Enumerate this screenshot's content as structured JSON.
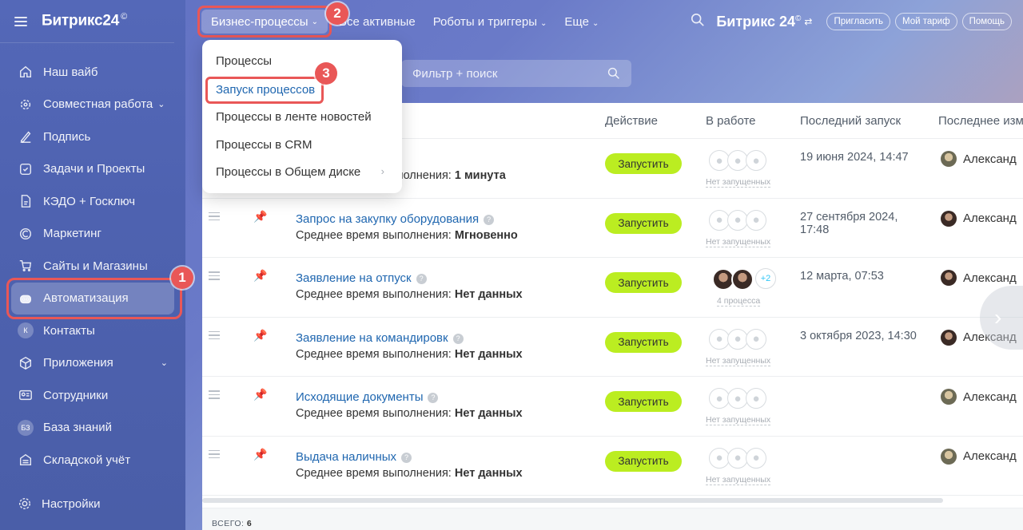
{
  "sidebar": {
    "logo": "Битрикс24",
    "logo_mark": "©",
    "items": [
      {
        "label": "Наш вайб",
        "icon": "home-icon"
      },
      {
        "label": "Совместная работа",
        "icon": "collab-icon"
      },
      {
        "label": "Подпись",
        "icon": "signature-icon"
      },
      {
        "label": "Задачи и Проекты",
        "icon": "tasks-icon"
      },
      {
        "label": "КЭДО + Госключ",
        "icon": "doc-icon"
      },
      {
        "label": "Маркетинг",
        "icon": "marketing-icon"
      },
      {
        "label": "Сайты и Магазины",
        "icon": "cart-icon"
      },
      {
        "label": "Автоматизация",
        "icon": "robot-icon"
      },
      {
        "label": "Контакты",
        "letter": "К"
      },
      {
        "label": "Приложения",
        "icon": "apps-icon"
      },
      {
        "label": "Сотрудники",
        "icon": "employees-icon"
      },
      {
        "label": "База знаний",
        "letter": "БЗ"
      },
      {
        "label": "Складской учёт",
        "icon": "warehouse-icon"
      }
    ],
    "settings": "Настройки"
  },
  "topbar": {
    "tabs": [
      "Бизнес-процессы",
      "Все активные",
      "Роботы и триггеры",
      "Еще"
    ],
    "logo": "Битрикс 24",
    "logo_mark": "©",
    "invite": "Пригласить",
    "plan": "Мой тариф",
    "help": "Помощь"
  },
  "dropdown": {
    "items": [
      "Процессы",
      "Запуск процессов",
      "Процессы в ленте новостей",
      "Процессы в CRM",
      "Процессы в Общем диске"
    ]
  },
  "filter": {
    "placeholder": "Фильтр + поиск"
  },
  "table": {
    "headers": [
      "Действие",
      "В работе",
      "Последний запуск",
      "Последнее изм"
    ],
    "run_label": "Запустить",
    "desc_prefix": "Среднее время выполнения: ",
    "rows": [
      {
        "name": "",
        "avg": "1 минута",
        "in_work": "Нет запущенных",
        "last_run": "19 июня 2024, 14:47",
        "editor": "Александ"
      },
      {
        "name": "Запрос на закупку оборудования",
        "avg": "Мгновенно",
        "in_work": "Нет запущенных",
        "last_run": "27 сентября 2024, 17:48",
        "editor": "Александ"
      },
      {
        "name": "Заявление на отпуск",
        "avg": "Нет данных",
        "in_work": "4 процесса",
        "extra": "+2",
        "last_run": "12 марта, 07:53",
        "editor": "Александ"
      },
      {
        "name": "Заявление на командировк",
        "avg": "Нет данных",
        "in_work": "Нет запущенных",
        "last_run": "3 октября 2023, 14:30",
        "editor": "Александ"
      },
      {
        "name": "Исходящие документы",
        "avg": "Нет данных",
        "in_work": "Нет запущенных",
        "last_run": "",
        "editor": "Александ"
      },
      {
        "name": "Выдача наличных",
        "avg": "Нет данных",
        "in_work": "Нет запущенных",
        "last_run": "",
        "editor": "Александ"
      }
    ],
    "total_label": "ВСЕГО:",
    "total": "6"
  },
  "badges": [
    "1",
    "2",
    "3"
  ],
  "colors": {
    "accent": "#e95757",
    "run_button": "#bbed21",
    "link": "#2067b0"
  }
}
